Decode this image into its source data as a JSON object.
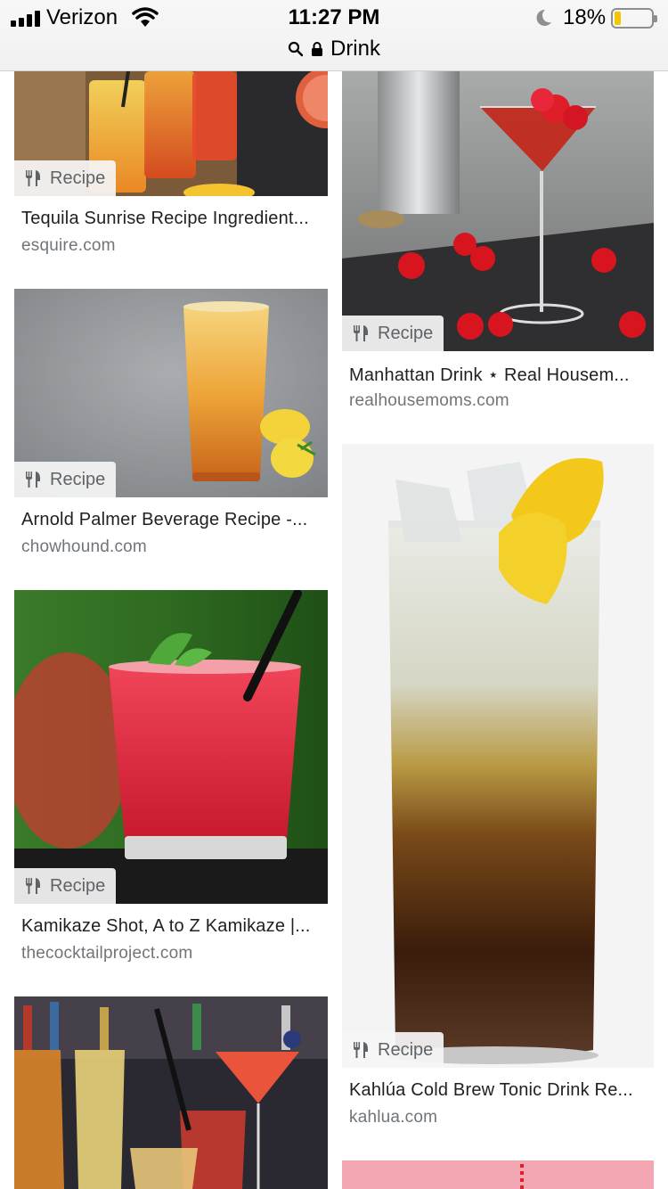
{
  "status_bar": {
    "carrier": "Verizon",
    "time": "11:27 PM",
    "battery_percent": "18%",
    "battery_level": 0.18,
    "battery_color": "#f4c500"
  },
  "url_bar": {
    "text": "Drink",
    "icons": [
      "search-icon",
      "lock-icon"
    ]
  },
  "results": [
    {
      "badge": "Recipe",
      "title": "Tequila Sunrise Recipe Ingredient...",
      "source": "esquire.com"
    },
    {
      "badge": "Recipe",
      "title": "Manhattan Drink ⋆ Real Housem...",
      "source": "realhousemoms.com"
    },
    {
      "badge": "Recipe",
      "title": "Arnold Palmer Beverage Recipe -...",
      "source": "chowhound.com"
    },
    {
      "badge": "Recipe",
      "title": "Kamikaze Shot, A to Z Kamikaze |...",
      "source": "thecocktailproject.com"
    },
    {
      "badge": "Recipe",
      "title": "Kahlúa Cold Brew Tonic Drink Re...",
      "source": "kahlua.com"
    }
  ]
}
